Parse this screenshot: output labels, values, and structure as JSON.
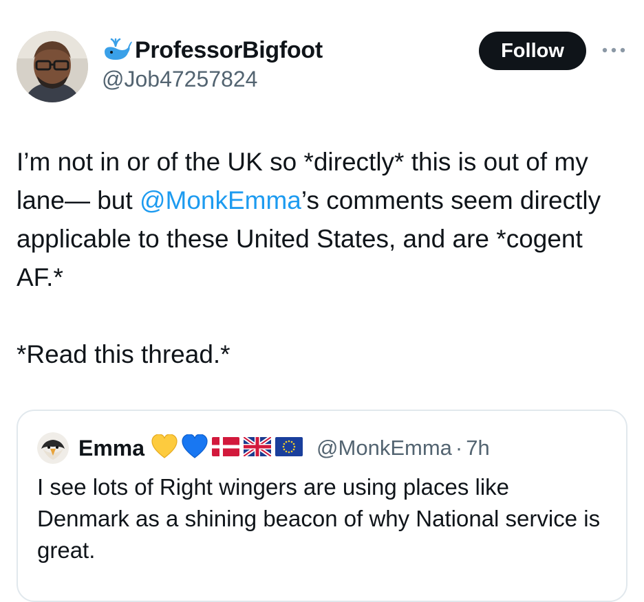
{
  "tweet": {
    "author": {
      "display_name": "ProfessorBigfoot",
      "handle": "@Job47257824",
      "badge_icon": "whale-icon"
    },
    "follow_label": "Follow",
    "more_icon": "more-horizontal-icon",
    "text": {
      "part1": "I’m not in or of the UK so *directly* this is out of my lane— but ",
      "mention": "@MonkEmma",
      "part2": "’s comments seem directly applicable to these United States, and are *cogent AF.*\n\n*Read this thread.*"
    }
  },
  "quote": {
    "author": {
      "display_name": "Emma",
      "handle": "@MonkEmma",
      "separator": "·",
      "time": "7h",
      "emojis": [
        "yellow-heart-icon",
        "blue-heart-icon",
        "denmark-flag-icon",
        "uk-flag-icon",
        "eu-flag-icon"
      ]
    },
    "text": "I see lots of Right wingers are using places like Denmark as a shining beacon of why National service is great."
  },
  "colors": {
    "text": "#0f1419",
    "secondary": "#536471",
    "link": "#1d9bf0",
    "button_bg": "#0f1419",
    "border": "#e1e8ed"
  }
}
